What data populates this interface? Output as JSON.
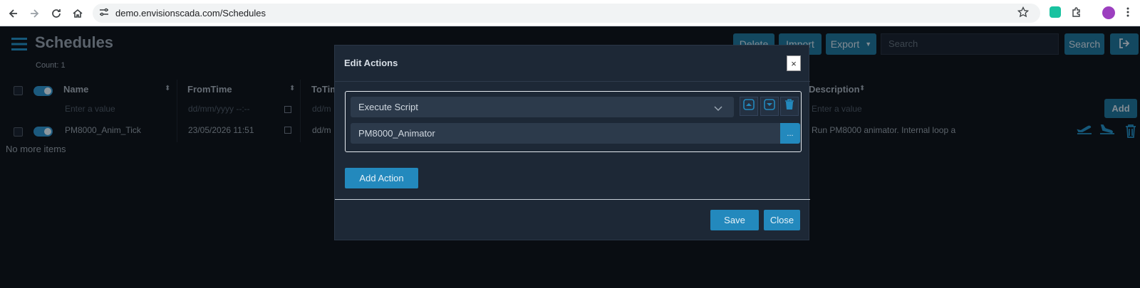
{
  "browser": {
    "url": "demo.envisionscada.com/Schedules"
  },
  "page": {
    "title": "Schedules",
    "count_label": "Count: 1"
  },
  "toolbar": {
    "delete_label": "Delete",
    "import_label": "Import",
    "export_label": "Export",
    "search_placeholder": "Search",
    "search_button": "Search"
  },
  "table": {
    "columns": [
      "Name",
      "FromTime",
      "ToTime",
      "Description"
    ],
    "filter_placeholder": "Enter a value",
    "date_placeholder": "dd/mm/yyyy --:--",
    "date_placeholder_short": "dd/m",
    "add_label": "Add",
    "rows": [
      {
        "name": "PM8000_Anim_Tick",
        "from_time": "23/05/2026 11:51",
        "to_time": "dd/m",
        "description": "Run PM8000 animator. Internal loop a"
      }
    ],
    "no_more_items": "No more items"
  },
  "modal": {
    "title": "Edit Actions",
    "close_x": "×",
    "action_type": "Execute Script",
    "script_name": "PM8000_Animator",
    "browse_label": "...",
    "add_action_label": "Add Action",
    "save_label": "Save",
    "close_label": "Close"
  },
  "colors": {
    "accent": "#2389bd",
    "background": "#0e141c",
    "modal_bg": "#1d2836"
  }
}
